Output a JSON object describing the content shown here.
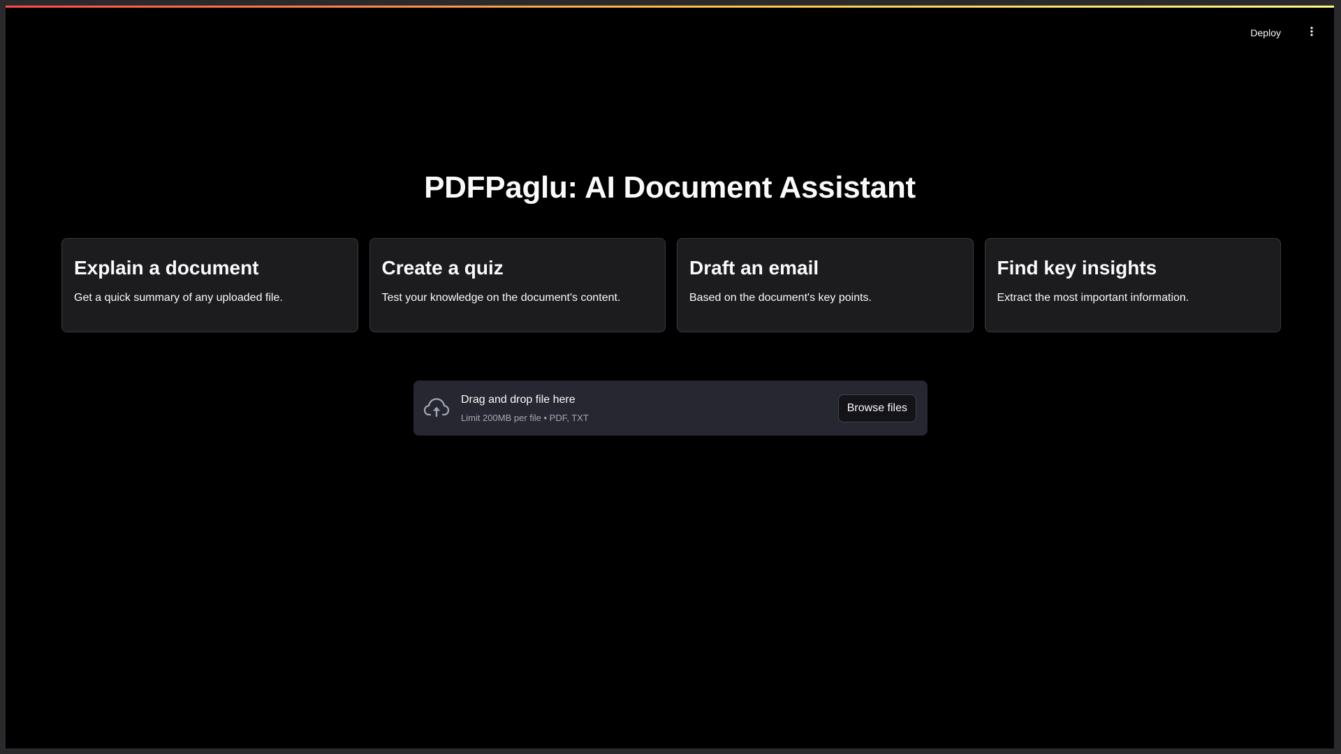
{
  "header": {
    "deploy_label": "Deploy",
    "menu_icon": "more-vertical-icon"
  },
  "main": {
    "title": "PDFPaglu: AI Document Assistant",
    "cards": [
      {
        "title": "Explain a document",
        "description": "Get a quick summary of any uploaded file."
      },
      {
        "title": "Create a quiz",
        "description": "Test your knowledge on the document's content."
      },
      {
        "title": "Draft an email",
        "description": "Based on the document's key points."
      },
      {
        "title": "Find key insights",
        "description": "Extract the most important information."
      }
    ]
  },
  "uploader": {
    "icon": "cloud-upload-icon",
    "drop_text": "Drag and drop file here",
    "limit_text": "Limit 200MB per file • PDF, TXT",
    "browse_label": "Browse files"
  },
  "colors": {
    "background": "#000000",
    "card_background": "#1c1c1f",
    "uploader_background": "#262730",
    "text": "#fafafa",
    "accent_gradient_start": "#ff4b4b",
    "accent_gradient_end": "#fffd80"
  }
}
